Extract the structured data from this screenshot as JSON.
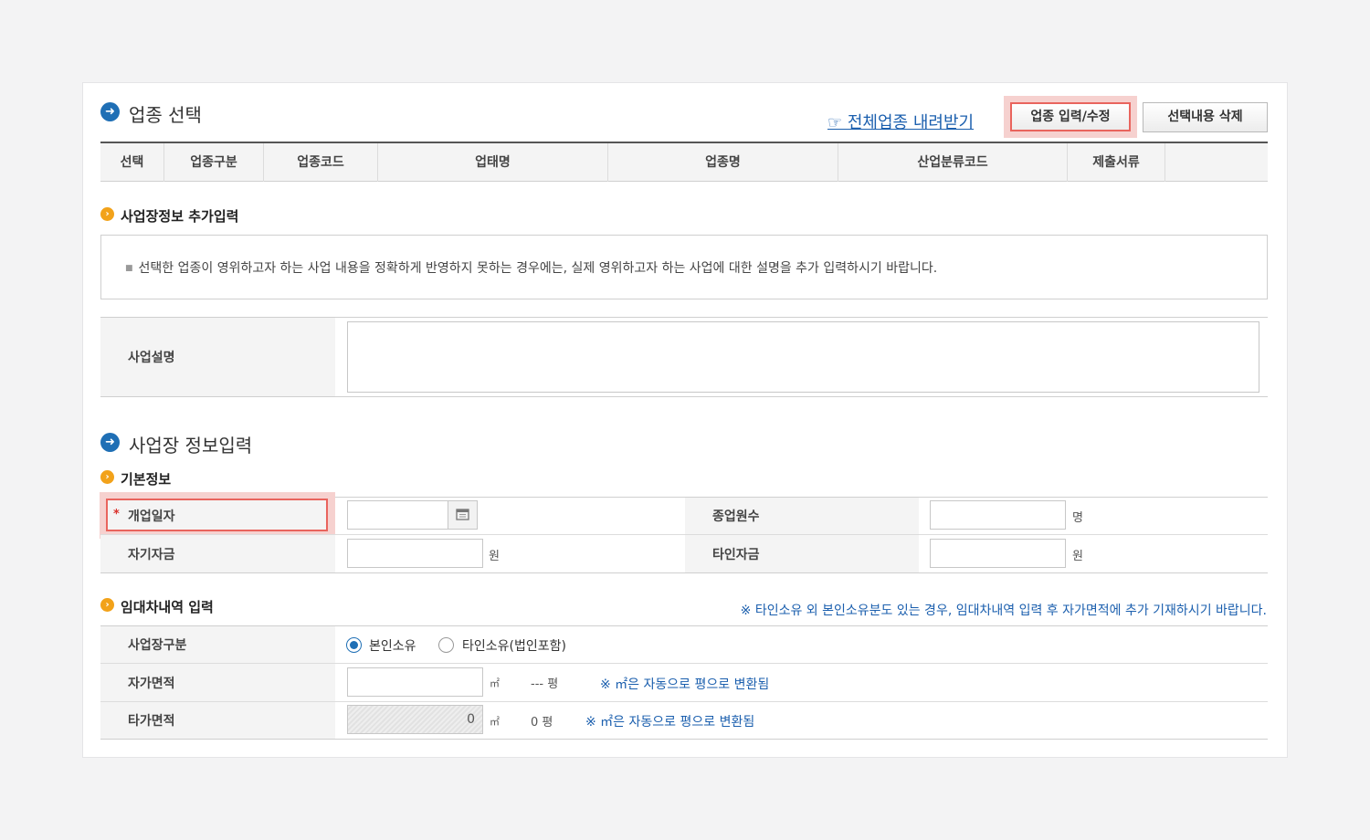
{
  "section1": {
    "title": "업종 선택",
    "download_link": "☞ 전체업종 내려받기",
    "btn_edit": "업종 입력/수정",
    "btn_delete": "선택내용 삭제"
  },
  "table_headers": [
    "선택",
    "업종구분",
    "업종코드",
    "업태명",
    "업종명",
    "산업분류코드",
    "제출서류"
  ],
  "extra_info": {
    "title": "사업장정보 추가입력",
    "note": "선택한 업종이 영위하고자 하는 사업 내용을 정확하게 반영하지 못하는 경우에는, 실제 영위하고자 하는 사업에 대한 설명을 추가 입력하시기 바랍니다.",
    "desc_label": "사업설명",
    "desc_value": ""
  },
  "section2": {
    "title": "사업장 정보입력",
    "basic_title": "기본정보"
  },
  "basic": {
    "required_mark": "*",
    "open_date_label": "개업일자",
    "employees_label": "종업원수",
    "employees_unit": "명",
    "own_fund_label": "자기자금",
    "own_fund_unit": "원",
    "other_fund_label": "타인자금",
    "other_fund_unit": "원"
  },
  "lease": {
    "title": "임대차내역 입력",
    "note": "※ 타인소유 외 본인소유분도 있는 경우, 임대차내역 입력 후 자가면적에 추가 기재하시기 바랍니다.",
    "place_type_label": "사업장구분",
    "option_own": "본인소유",
    "option_other": "타인소유(법인포함)",
    "own_area_label": "자가면적",
    "own_area_unit": "㎡",
    "own_area_pyeong": "--- 평",
    "other_area_label": "타가면적",
    "other_area_value": "0",
    "other_area_unit": "㎡",
    "other_area_pyeong": "0 평",
    "convert_note": "※ ㎡은 자동으로 평으로 변환됨"
  }
}
